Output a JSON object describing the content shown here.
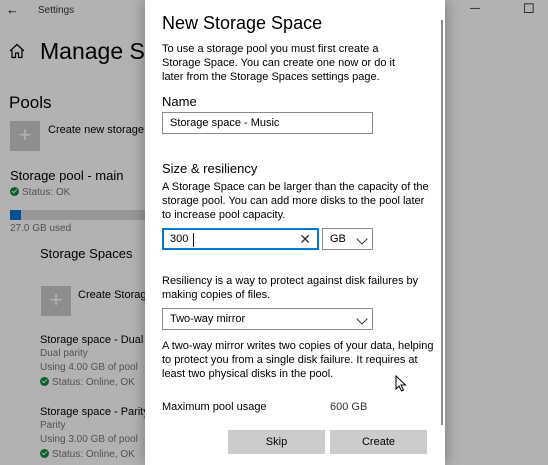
{
  "window": {
    "title": "Settings",
    "back_glyph": "←",
    "minimize_glyph": "—",
    "maximize_glyph": "☐"
  },
  "settings": {
    "page_title": "Manage Sto",
    "pools_heading": "Pools",
    "create_pool_label": "Create new storage p",
    "pool_name": "Storage pool - main",
    "pool_status": "Status: OK",
    "pool_usage_text": "27.0 GB used",
    "pool_usage_fraction": 0.08,
    "spaces_heading": "Storage Spaces",
    "create_space_label": "Create Storag",
    "spaces": [
      {
        "name": "Storage space - Dual p",
        "type": "Dual parity",
        "usage": "Using 4.00 GB of pool",
        "status": "Status: Online, OK"
      },
      {
        "name": "Storage space - Parity",
        "type": "Parity",
        "usage": "Using 3.00 GB of pool",
        "status": "Status: Online, OK"
      }
    ]
  },
  "dialog": {
    "title": "New Storage Space",
    "intro": "To use a storage pool you must first create a Storage Space. You can create one now or do it later from the Storage Spaces settings page.",
    "name_label": "Name",
    "name_value": "Storage space - Music",
    "size_heading": "Size & resiliency",
    "size_desc": "A Storage Space can be larger than the capacity of the storage pool. You can add more disks to the pool later to increase pool capacity.",
    "size_value": "300",
    "size_clear_glyph": "✕",
    "unit_value": "GB",
    "resiliency_desc": "Resiliency is a way to protect against disk failures by making copies of files.",
    "resiliency_value": "Two-way mirror",
    "mirror_desc": "A two-way mirror writes two copies of your data, helping to protect you from a single disk failure. It requires at least two physical disks in the pool.",
    "max_usage_label": "Maximum pool usage",
    "max_usage_value": "600 GB",
    "skip_label": "Skip",
    "create_label": "Create"
  }
}
